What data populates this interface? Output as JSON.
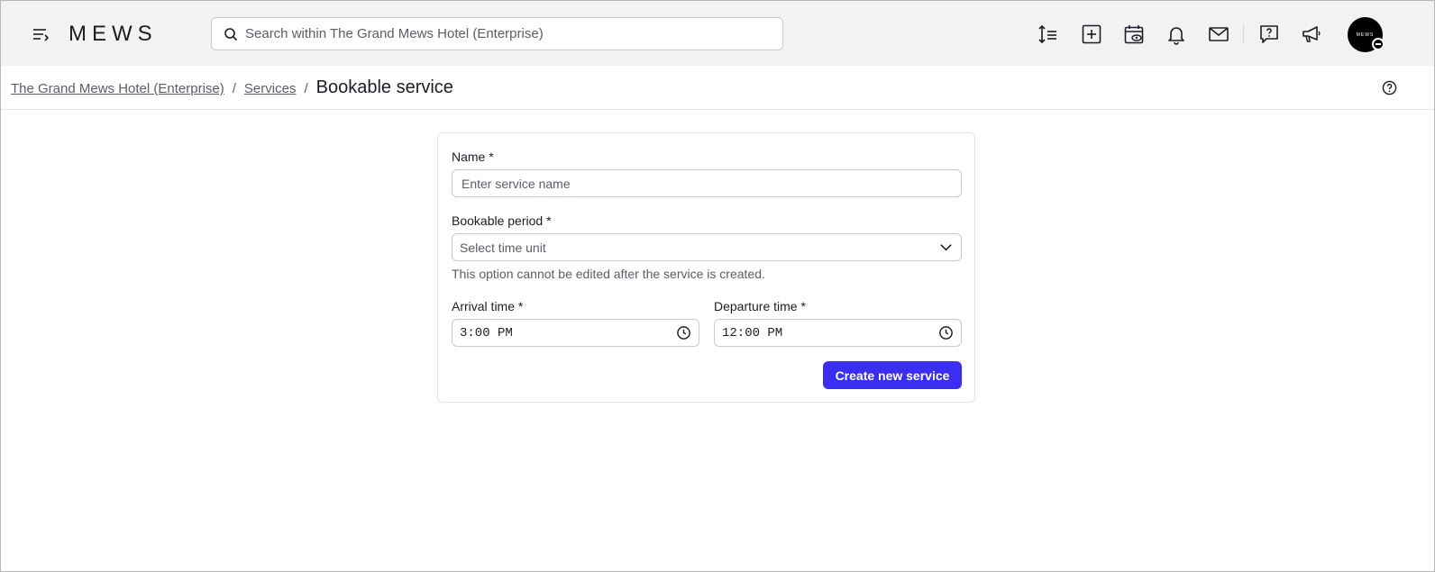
{
  "header": {
    "logo": "MEWS",
    "search": {
      "placeholder": "Search within The Grand Mews Hotel (Enterprise)",
      "value": ""
    },
    "icons": [
      "menu-icon",
      "sort-icon",
      "add-icon",
      "calendar-view-icon",
      "bell-icon",
      "mail-icon",
      "help-chat-icon",
      "megaphone-icon"
    ],
    "avatar_text": "MEWS"
  },
  "breadcrumb": {
    "items": [
      "The Grand Mews Hotel (Enterprise)",
      "Services"
    ],
    "separator": "/",
    "current": "Bookable service"
  },
  "form": {
    "name": {
      "label": "Name *",
      "placeholder": "Enter service name",
      "value": ""
    },
    "bookable_period": {
      "label": "Bookable period *",
      "placeholder": "Select time unit",
      "hint": "This option cannot be edited after the service is created."
    },
    "arrival": {
      "label": "Arrival time *",
      "value": "3:00 PM"
    },
    "departure": {
      "label": "Departure time *",
      "value": "12:00 PM"
    },
    "submit_label": "Create new service"
  },
  "colors": {
    "accent": "#3a2ef0",
    "topbar_bg": "#f2f2f2"
  }
}
